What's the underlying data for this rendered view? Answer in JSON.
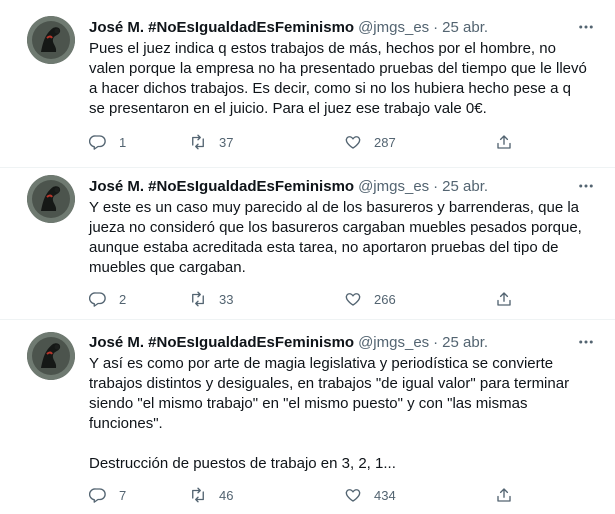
{
  "tweets": [
    {
      "name": "José M. #NoEsIgualdadEsFeminismo",
      "handle": "@jmgs_es",
      "date": "25 abr.",
      "text": "Pues el juez indica q estos trabajos de más, hechos por el hombre, no valen porque la empresa no ha presentado pruebas del tiempo que le llevó a hacer dichos trabajos. Es decir, como si no los hubiera hecho pese a q se presentaron en el juicio. Para el juez ese trabajo vale 0€.",
      "replies": "1",
      "retweets": "37",
      "likes": "287"
    },
    {
      "name": "José M. #NoEsIgualdadEsFeminismo",
      "handle": "@jmgs_es",
      "date": "25 abr.",
      "text": "Y este es un caso muy parecido al de los basureros y barrenderas, que la jueza no consideró que los basureros cargaban muebles pesados porque, aunque estaba acreditada esta tarea, no aportaron pruebas del tipo de muebles que cargaban.",
      "replies": "2",
      "retweets": "33",
      "likes": "266"
    },
    {
      "name": "José M. #NoEsIgualdadEsFeminismo",
      "handle": "@jmgs_es",
      "date": "25 abr.",
      "text": "Y así es como por arte de magia legislativa y periodística se convierte trabajos distintos y desiguales, en trabajos \"de igual valor\" para terminar siendo \"el mismo trabajo\" en \"el mismo puesto\" y con \"las mismas funciones\".\n\nDestrucción de puestos de trabajo en 3, 2, 1...",
      "replies": "7",
      "retweets": "46",
      "likes": "434"
    }
  ],
  "icons": {
    "more": "more-icon",
    "reply": "reply-icon",
    "retweet": "retweet-icon",
    "like": "like-icon",
    "share": "share-icon"
  },
  "colors": {
    "text": "#0f1419",
    "secondary": "#536471",
    "divider": "#eff3f4"
  }
}
